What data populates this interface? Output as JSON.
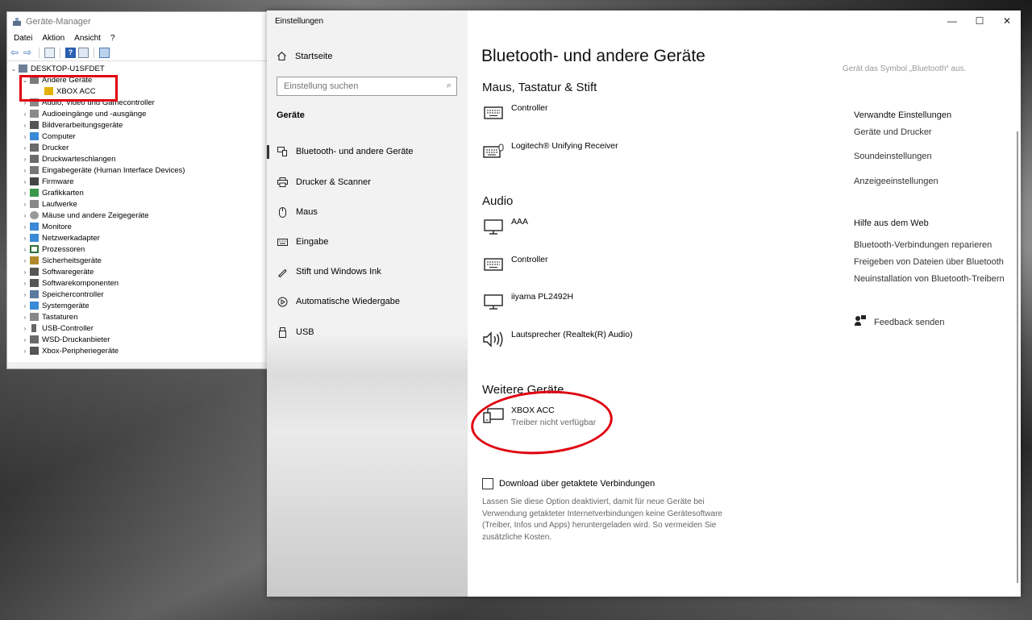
{
  "device_manager": {
    "title": "Geräte-Manager",
    "menu": [
      "Datei",
      "Aktion",
      "Ansicht",
      "?"
    ],
    "computer_name": "DESKTOP-U1SFDET",
    "tree": [
      {
        "label": "Andere Geräte",
        "expanded": true,
        "level": 1,
        "icon": "unknown-device-icon"
      },
      {
        "label": "XBOX ACC",
        "level": 2,
        "icon": "warning-device-icon"
      },
      {
        "label": "Audio, Video und Gamecontroller",
        "level": 1,
        "icon": "speaker-icon"
      },
      {
        "label": "Audioeingänge und -ausgänge",
        "level": 1,
        "icon": "speaker-icon"
      },
      {
        "label": "Bildverarbeitungsgeräte",
        "level": 1,
        "icon": "camera-icon"
      },
      {
        "label": "Computer",
        "level": 1,
        "icon": "computer-icon"
      },
      {
        "label": "Drucker",
        "level": 1,
        "icon": "printer-icon"
      },
      {
        "label": "Druckwarteschlangen",
        "level": 1,
        "icon": "printer-icon"
      },
      {
        "label": "Eingabegeräte (Human Interface Devices)",
        "level": 1,
        "icon": "hid-icon"
      },
      {
        "label": "Firmware",
        "level": 1,
        "icon": "chip-icon"
      },
      {
        "label": "Grafikkarten",
        "level": 1,
        "icon": "display-adapter-icon"
      },
      {
        "label": "Laufwerke",
        "level": 1,
        "icon": "drive-icon"
      },
      {
        "label": "Mäuse und andere Zeigegeräte",
        "level": 1,
        "icon": "mouse-icon"
      },
      {
        "label": "Monitore",
        "level": 1,
        "icon": "monitor-icon"
      },
      {
        "label": "Netzwerkadapter",
        "level": 1,
        "icon": "network-icon"
      },
      {
        "label": "Prozessoren",
        "level": 1,
        "icon": "cpu-icon"
      },
      {
        "label": "Sicherheitsgeräte",
        "level": 1,
        "icon": "security-icon"
      },
      {
        "label": "Softwaregeräte",
        "level": 1,
        "icon": "software-icon"
      },
      {
        "label": "Softwarekomponenten",
        "level": 1,
        "icon": "software-icon"
      },
      {
        "label": "Speichercontroller",
        "level": 1,
        "icon": "storage-icon"
      },
      {
        "label": "Systemgeräte",
        "level": 1,
        "icon": "system-icon"
      },
      {
        "label": "Tastaturen",
        "level": 1,
        "icon": "keyboard-icon"
      },
      {
        "label": "USB-Controller",
        "level": 1,
        "icon": "usb-icon"
      },
      {
        "label": "WSD-Druckanbieter",
        "level": 1,
        "icon": "printer-icon"
      },
      {
        "label": "Xbox-Peripheriegeräte",
        "level": 1,
        "icon": "gamepad-icon"
      }
    ]
  },
  "settings": {
    "app_title": "Einstellungen",
    "home": "Startseite",
    "search_placeholder": "Einstellung suchen",
    "section": "Geräte",
    "nav": [
      {
        "label": "Bluetooth- und andere Geräte",
        "icon": "bluetooth-devices-icon",
        "active": true
      },
      {
        "label": "Drucker & Scanner",
        "icon": "printer-icon"
      },
      {
        "label": "Maus",
        "icon": "mouse-icon"
      },
      {
        "label": "Eingabe",
        "icon": "keyboard-icon"
      },
      {
        "label": "Stift und Windows Ink",
        "icon": "pen-icon"
      },
      {
        "label": "Automatische Wiedergabe",
        "icon": "autoplay-icon"
      },
      {
        "label": "USB",
        "icon": "usb-icon"
      }
    ],
    "page_title": "Bluetooth- und andere Geräte",
    "scroll_hint": "Gerät das Symbol „Bluetooth“ aus.",
    "groups": {
      "input": {
        "title": "Maus, Tastatur & Stift",
        "devices": [
          {
            "name": "Controller",
            "icon": "keyboard-icon"
          },
          {
            "name": "Logitech® Unifying Receiver",
            "icon": "keyboard-icon"
          }
        ]
      },
      "audio": {
        "title": "Audio",
        "devices": [
          {
            "name": "AAA",
            "icon": "monitor-icon"
          },
          {
            "name": "Controller",
            "icon": "keyboard-icon"
          },
          {
            "name": "iiyama PL2492H",
            "icon": "monitor-icon"
          },
          {
            "name": "Lautsprecher (Realtek(R) Audio)",
            "icon": "speaker-icon"
          }
        ]
      },
      "other": {
        "title": "Weitere Geräte",
        "devices": [
          {
            "name": "XBOX ACC",
            "status": "Treiber nicht verfügbar",
            "icon": "generic-device-icon"
          }
        ]
      }
    },
    "metered_checkbox_label": "Download über getaktete Verbindungen",
    "metered_checked": false,
    "metered_description": "Lassen Sie diese Option deaktiviert, damit für neue Geräte bei Verwendung getakteter Internetverbindungen keine Gerätesoftware (Treiber, Infos und Apps) heruntergeladen wird. So vermeiden Sie zusätzliche Kosten.",
    "related_title": "Verwandte Einstellungen",
    "related_links": [
      "Geräte und Drucker",
      "Soundeinstellungen",
      "Anzeigeeinstellungen"
    ],
    "help_title": "Hilfe aus dem Web",
    "help_links": [
      "Bluetooth-Verbindungen reparieren",
      "Freigeben von Dateien über Bluetooth",
      "Neuinstallation von Bluetooth-Treibern"
    ],
    "feedback": "Feedback senden",
    "window_controls": {
      "minimize": "—",
      "maximize": "☐",
      "close": "✕"
    }
  }
}
